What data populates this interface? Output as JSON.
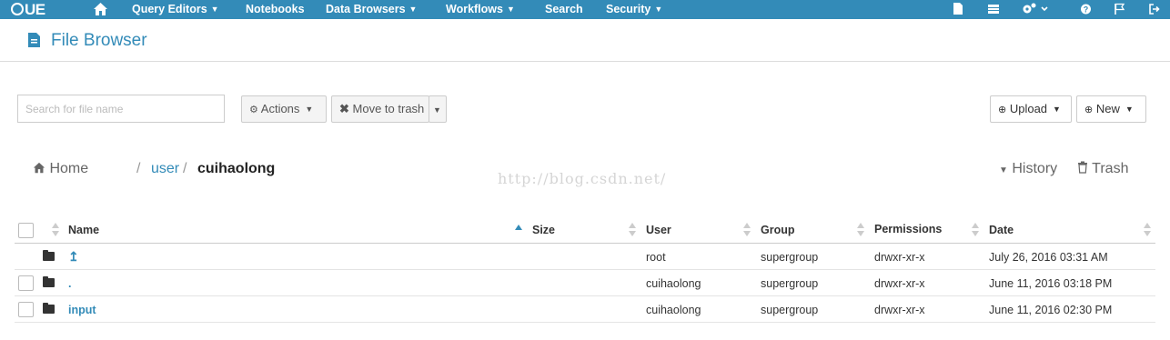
{
  "nav": {
    "logo": "UE",
    "items": [
      {
        "label": "Query Editors"
      },
      {
        "label": "Notebooks"
      },
      {
        "label": "Data Browsers"
      },
      {
        "label": "Workflows"
      },
      {
        "label": "Search"
      },
      {
        "label": "Security"
      }
    ],
    "icons": [
      "home-icon",
      "file-icon",
      "table-icon",
      "cogs-icon",
      "help-icon",
      "flag-icon",
      "logout-icon"
    ]
  },
  "page": {
    "title": "File Browser"
  },
  "toolbar": {
    "search_placeholder": "Search for file name",
    "actions_label": "Actions",
    "move_to_trash_label": "Move to trash",
    "upload_label": "Upload",
    "new_label": "New"
  },
  "breadcrumb": {
    "home": "Home",
    "sep": "/",
    "segments": [
      "user",
      "cuihaolong"
    ]
  },
  "watermark": "http://blog.csdn.net/",
  "links": {
    "history": "History",
    "trash": "Trash"
  },
  "table": {
    "columns": [
      "Name",
      "Size",
      "User",
      "Group",
      "Permissions",
      "Date"
    ],
    "rows": [
      {
        "name": "↥",
        "size": "",
        "user": "root",
        "group": "supergroup",
        "permissions": "drwxr-xr-x",
        "date": "July 26, 2016 03:31 AM"
      },
      {
        "name": ".",
        "size": "",
        "user": "cuihaolong",
        "group": "supergroup",
        "permissions": "drwxr-xr-x",
        "date": "June 11, 2016 03:18 PM"
      },
      {
        "name": "input",
        "size": "",
        "user": "cuihaolong",
        "group": "supergroup",
        "permissions": "drwxr-xr-x",
        "date": "June 11, 2016 02:30 PM"
      }
    ]
  },
  "colors": {
    "accent": "#338bb8"
  }
}
